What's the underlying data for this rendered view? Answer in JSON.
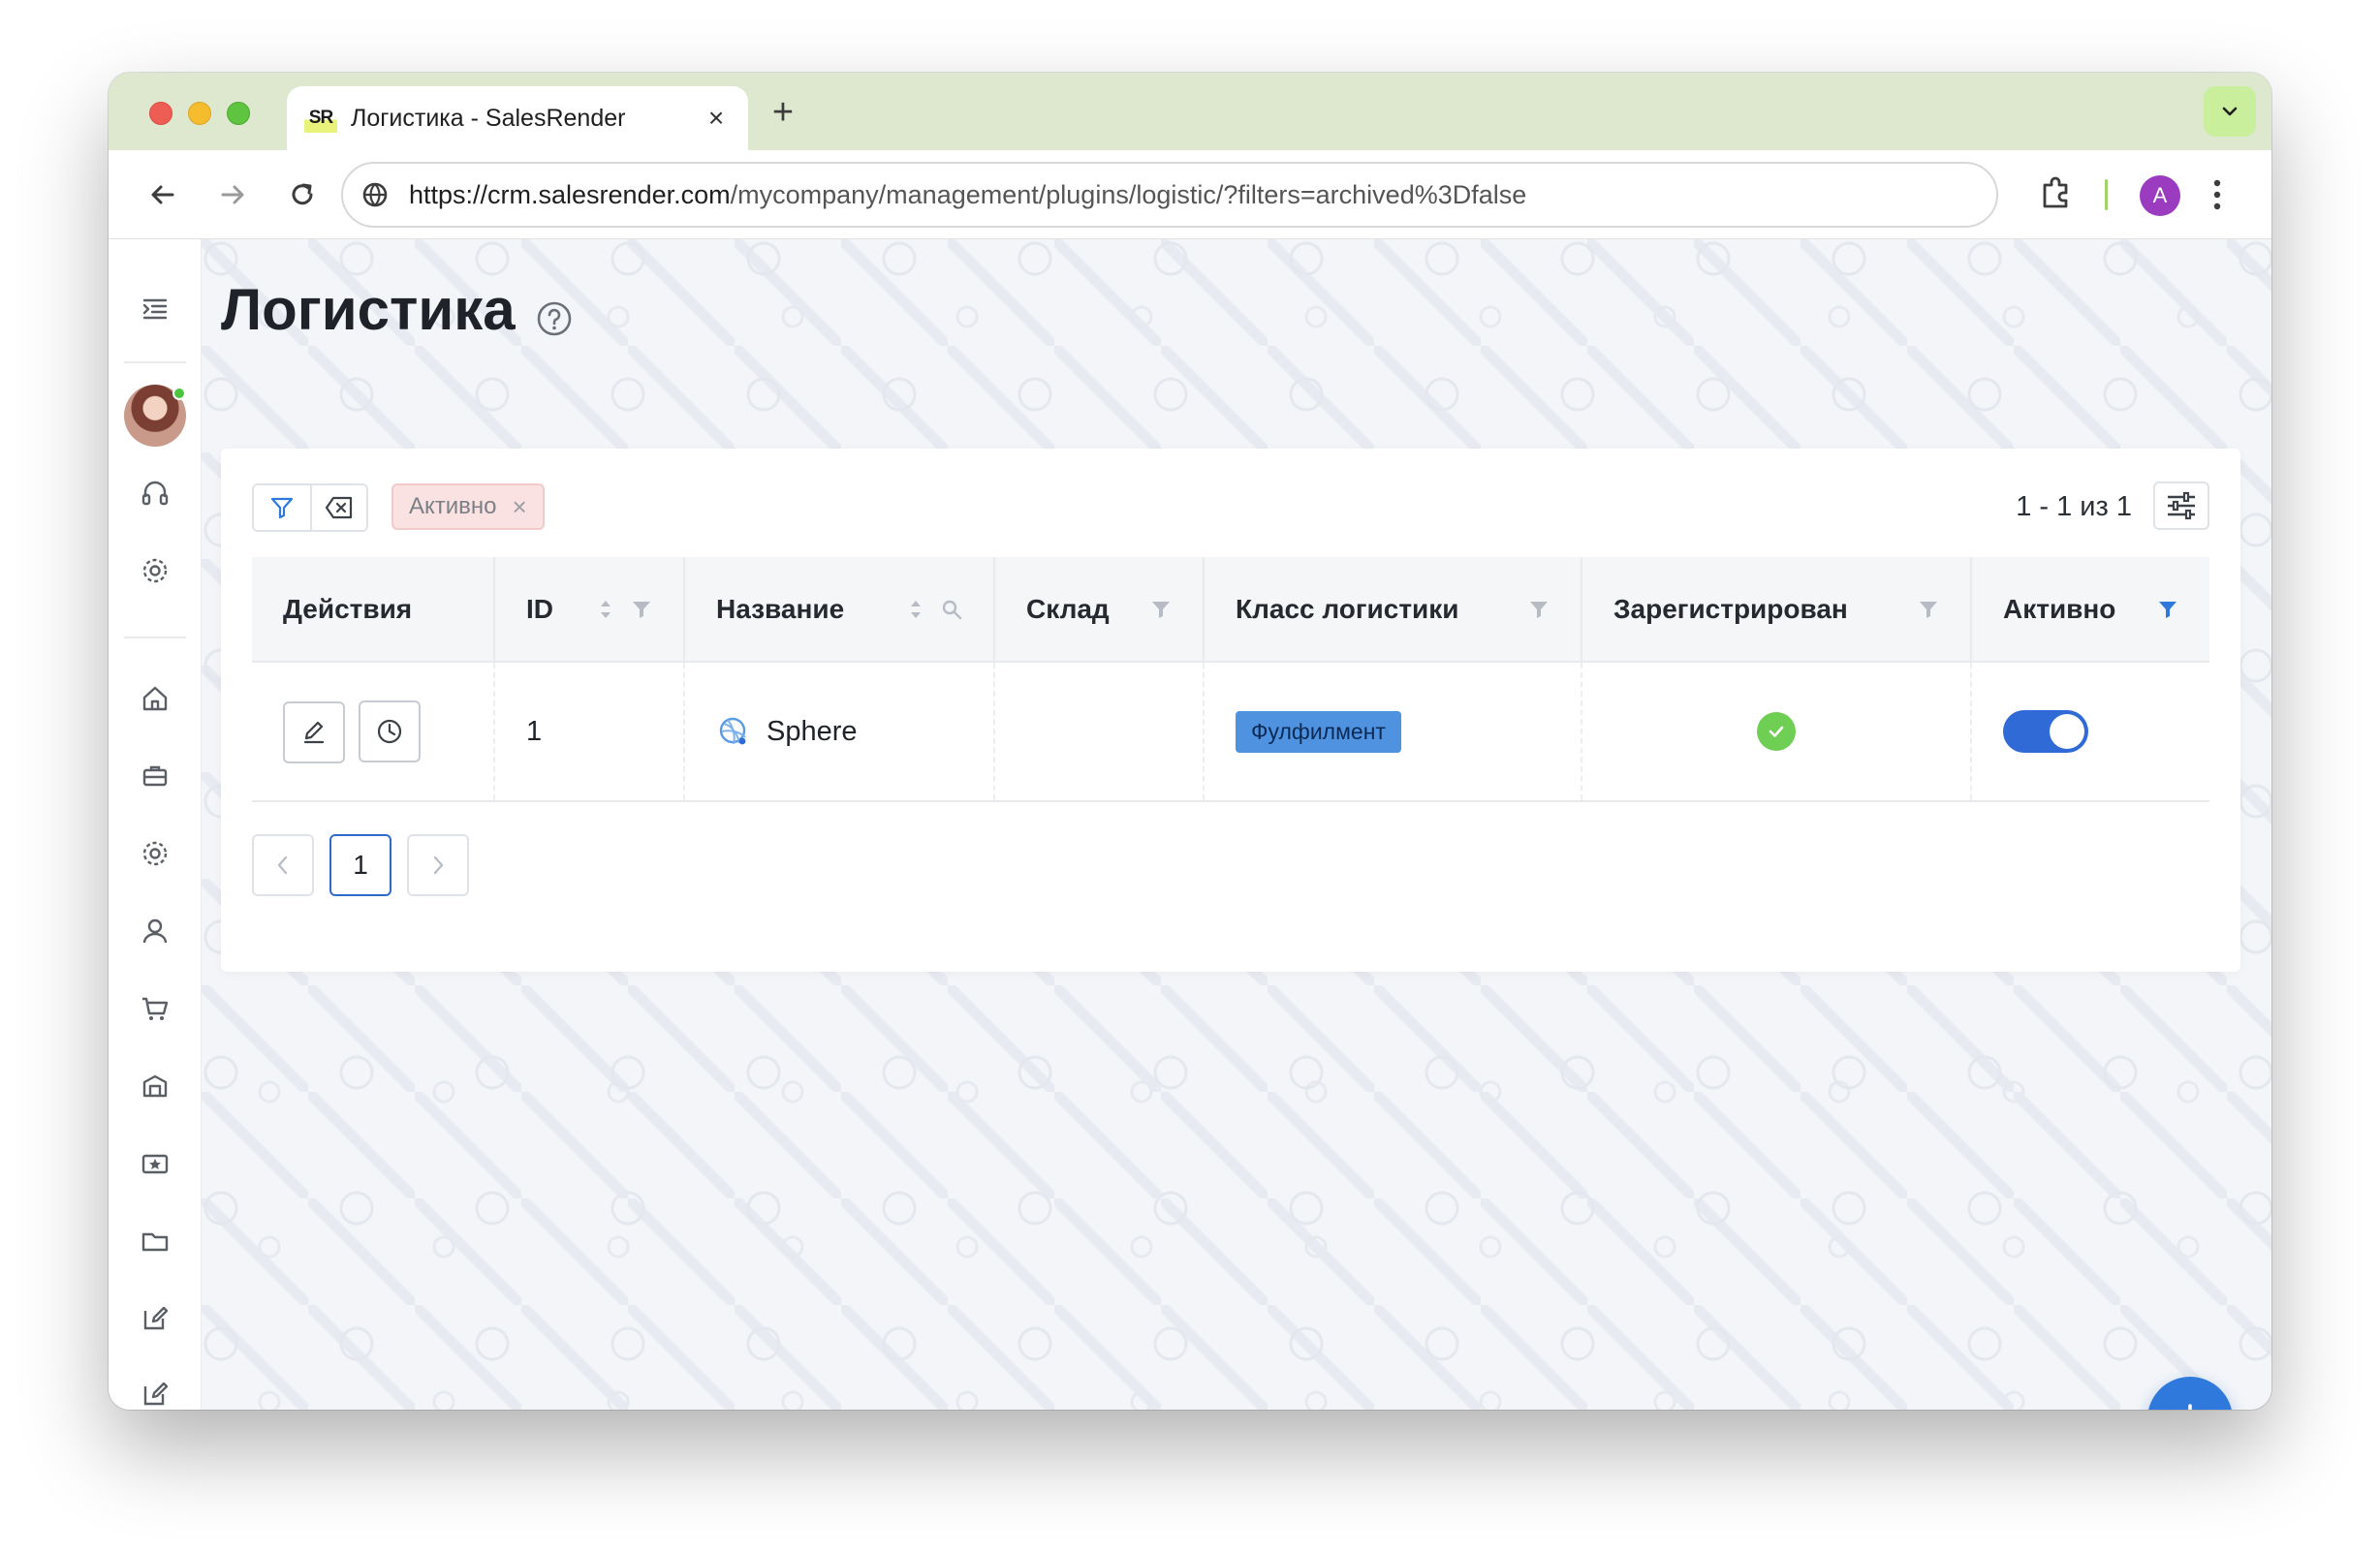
{
  "browser": {
    "tab_title": "Логистика - SalesRender",
    "tab_favicon": "SR",
    "url_host": "https://crm.salesrender.com",
    "url_path": "/mycompany/management/plugins/logistic/?filters=archived%3Dfalse",
    "profile_initial": "A"
  },
  "sidebar": {
    "icons": [
      "menu-icon",
      "headset-icon",
      "gear-icon",
      "home-icon",
      "briefcase-icon",
      "settings-icon",
      "user-icon",
      "cart-icon",
      "warehouse-icon",
      "star-ticket-icon",
      "folder-icon",
      "edit-icon",
      "edit-icon"
    ]
  },
  "page": {
    "title": "Логистика"
  },
  "filters": {
    "active_chip": "Активно",
    "count_text": "1 - 1 из 1"
  },
  "table": {
    "columns": [
      "Действия",
      "ID",
      "Название",
      "Склад",
      "Класс логистики",
      "Зарегистрирован",
      "Активно"
    ],
    "rows": [
      {
        "id": "1",
        "name": "Sphere",
        "warehouse": "",
        "logistic_class": "Фулфилмент",
        "registered": true,
        "active": true
      }
    ]
  },
  "pagination": {
    "current_page": "1"
  },
  "colors": {
    "accent": "#2f79dd",
    "badge": "#4f93e0",
    "success": "#6fcf54",
    "chip_bg": "#fbe2e2"
  }
}
